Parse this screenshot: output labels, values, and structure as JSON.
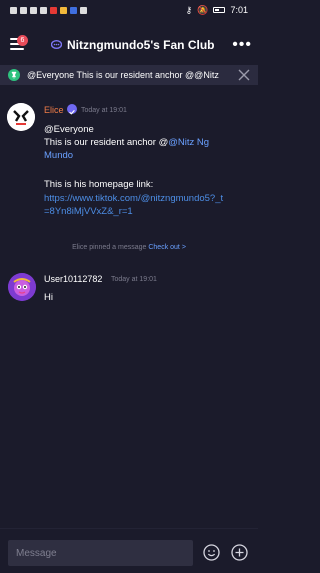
{
  "status_bar": {
    "time": "7:01"
  },
  "header": {
    "title": "Nitzngmundo5's Fan Club",
    "notification_count": "6"
  },
  "pinned_bar": {
    "text": "@Everyone  This is our resident anchor @@Nitz"
  },
  "messages": [
    {
      "author": "Elice",
      "time": "Today at 19:01",
      "line1": "@Everyone",
      "line2_prefix": "This is our resident anchor @",
      "line2_mention": "@Nitz Ng",
      "line3_mention": "Mundo",
      "line4": "This is his homepage link:",
      "link_line1": "https://www.tiktok.com/@nitzngmundo5?_t",
      "link_line2": "=8Yn8iMjVVxZ&_r=1"
    },
    {
      "author": "User10112782",
      "time": "Today at 19:01",
      "text": "Hi"
    }
  ],
  "system_message": {
    "text": "Elice pinned a message ",
    "action": "Check out >"
  },
  "input": {
    "placeholder": "Message"
  },
  "colors": {
    "background": "#1b1b2b",
    "link": "#4d8ee6",
    "author_elice": "#f17d48",
    "badge": "#e84c5a"
  }
}
